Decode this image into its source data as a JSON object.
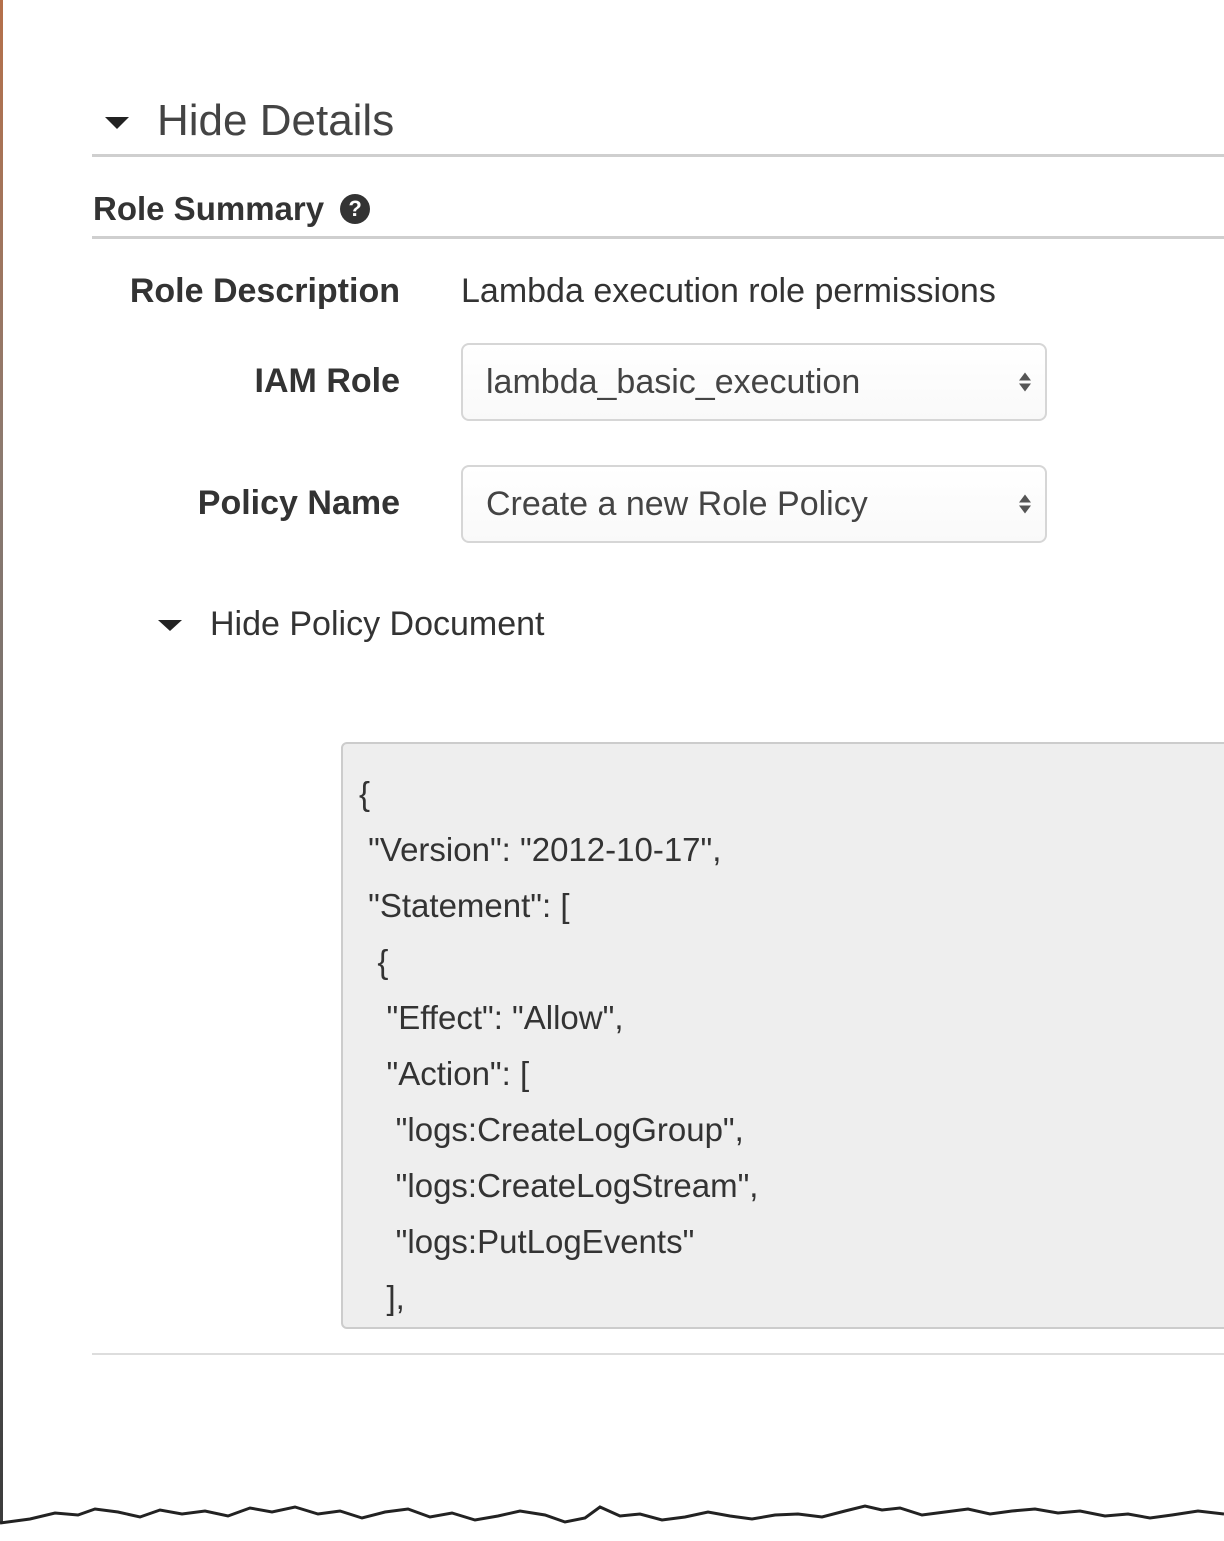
{
  "details_toggle": {
    "label": "Hide Details"
  },
  "role_summary": {
    "heading": "Role Summary"
  },
  "fields": {
    "role_description": {
      "label": "Role Description",
      "value": "Lambda execution role permissions"
    },
    "iam_role": {
      "label": "IAM Role",
      "selected": "lambda_basic_execution"
    },
    "policy_name": {
      "label": "Policy Name",
      "selected": "Create a new Role Policy"
    }
  },
  "policy_toggle": {
    "label": "Hide Policy Document"
  },
  "policy_document": {
    "lines": [
      "{",
      " \"Version\": \"2012-10-17\",",
      " \"Statement\": [",
      "  {",
      "   \"Effect\": \"Allow\",",
      "   \"Action\": [",
      "    \"logs:CreateLogGroup\",",
      "    \"logs:CreateLogStream\",",
      "    \"logs:PutLogEvents\"",
      "   ],"
    ]
  },
  "icons": {
    "section_caret": "caret-down-icon",
    "help": "question-circle-icon",
    "select_arrows": "updown-arrows-icon"
  },
  "colors": {
    "text": "#333333",
    "rule": "#cfcfcf",
    "code_background": "#eeeeee"
  }
}
